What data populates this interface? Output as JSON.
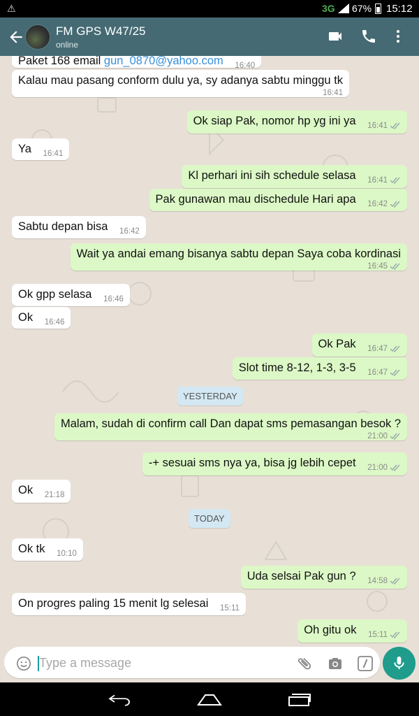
{
  "status_bar": {
    "warning_icon": "warning-triangle-icon",
    "network": "3G",
    "battery": "67%",
    "time": "15:12"
  },
  "header": {
    "title": "FM GPS W47/25",
    "subtitle": "online",
    "background": "#456a73",
    "icons": [
      "back-arrow-icon",
      "video-call-icon",
      "phone-icon",
      "more-vert-icon"
    ]
  },
  "chat": {
    "background": "#e8e0d7",
    "incoming_color": "#ffffff",
    "outgoing_color": "#dcf8c6",
    "messages": [
      {
        "dir": "in",
        "text": "Paket 168 email ",
        "link": "gun_0870@yahoo.com",
        "time": "16:40"
      },
      {
        "dir": "in",
        "text": "Kalau mau pasang conform dulu ya, sy adanya sabtu minggu tk",
        "time": "16:41"
      },
      {
        "dir": "out",
        "text": "Ok siap Pak, nomor hp yg ini ya",
        "time": "16:41"
      },
      {
        "dir": "in",
        "text": "Ya",
        "time": "16:41"
      },
      {
        "dir": "out",
        "text": "Kl perhari ini sih schedule selasa",
        "time": "16:41"
      },
      {
        "dir": "out",
        "text": "Pak gunawan mau dischedule Hari apa",
        "time": "16:42"
      },
      {
        "dir": "in",
        "text": "Sabtu depan bisa",
        "time": "16:42"
      },
      {
        "dir": "out",
        "text": "Wait ya andai emang bisanya sabtu depan Saya coba kordinasi",
        "time": "16:45"
      },
      {
        "dir": "in",
        "text": "Ok gpp selasa",
        "time": "16:46"
      },
      {
        "dir": "in",
        "text": "Ok",
        "time": "16:46"
      },
      {
        "dir": "out",
        "text": "Ok Pak",
        "time": "16:47"
      },
      {
        "dir": "out",
        "text": "Slot time 8-12, 1-3, 3-5",
        "time": "16:47"
      },
      {
        "dir": "out",
        "text": "Malam, sudah di confirm call Dan dapat sms pemasangan besok ?",
        "time": "21:00"
      },
      {
        "dir": "out",
        "text": "-+ sesuai sms nya ya, bisa jg lebih cepet",
        "time": "21:00"
      },
      {
        "dir": "in",
        "text": "Ok",
        "time": "21:18"
      },
      {
        "dir": "in",
        "text": "Ok tk",
        "time": "10:10"
      },
      {
        "dir": "out",
        "text": "Uda selsai Pak gun ?",
        "time": "14:58"
      },
      {
        "dir": "in",
        "text": "On progres paling 15 menit lg selesai",
        "time": "15:11"
      },
      {
        "dir": "out",
        "text": "Oh gitu ok",
        "time": "15:11"
      }
    ],
    "day_labels": {
      "yesterday": "YESTERDAY",
      "today": "TODAY"
    }
  },
  "input": {
    "placeholder": "Type a message",
    "icons": [
      "emoji-icon",
      "attachment-icon",
      "camera-icon",
      "slash-command-icon",
      "microphone-icon"
    ],
    "mic_color": "#1f9c8c"
  },
  "nav_bar": {
    "icons": [
      "back-nav-icon",
      "home-nav-icon",
      "recents-nav-icon"
    ]
  }
}
